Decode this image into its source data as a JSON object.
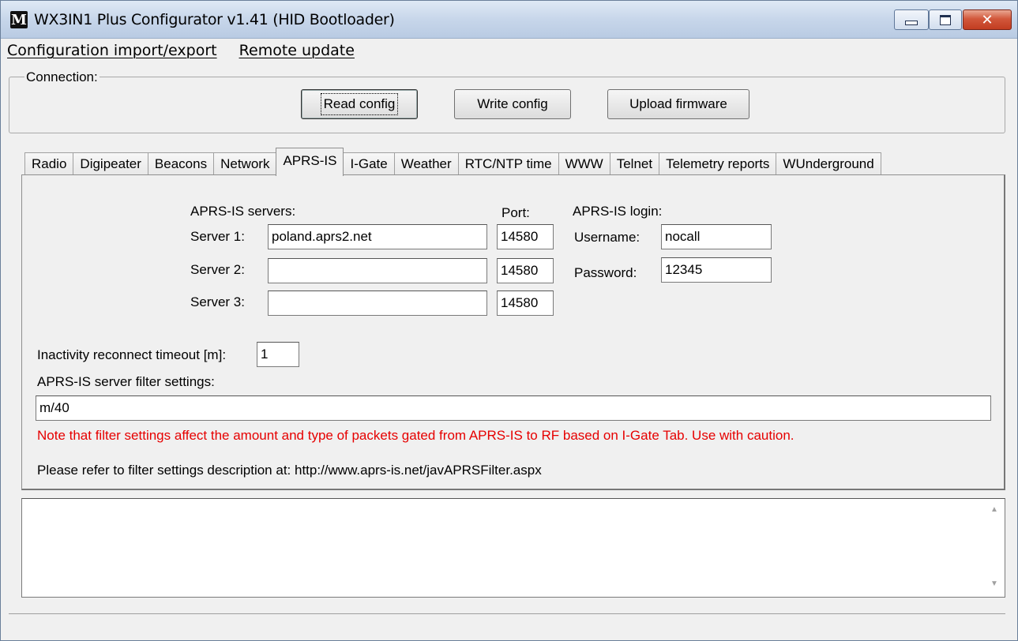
{
  "window": {
    "title": "WX3IN1 Plus Configurator v1.41 (HID Bootloader)",
    "icon_letter": "M"
  },
  "menu": {
    "items": [
      {
        "label": "C",
        "rest": "onfiguration import/export"
      },
      {
        "label": "R",
        "rest": "emote update"
      }
    ]
  },
  "connection": {
    "legend": "Connection:",
    "read_label": "Read config",
    "write_label": "Write config",
    "upload_label": "Upload firmware"
  },
  "tabs": [
    "Radio",
    "Digipeater",
    "Beacons",
    "Network",
    "APRS-IS",
    "I-Gate",
    "Weather",
    "RTC/NTP time",
    "WWW",
    "Telnet",
    "Telemetry reports",
    "WUnderground"
  ],
  "active_tab": "APRS-IS",
  "aprsis": {
    "servers_header": "APRS-IS servers:",
    "port_header": "Port:",
    "login_header": "APRS-IS login:",
    "servers": [
      {
        "label": "Server 1:",
        "value": "poland.aprs2.net",
        "port": "14580"
      },
      {
        "label": "Server 2:",
        "value": "",
        "port": "14580"
      },
      {
        "label": "Server 3:",
        "value": "",
        "port": "14580"
      }
    ],
    "username_label": "Username:",
    "username_value": "nocall",
    "password_label": "Password:",
    "password_value": "12345",
    "timeout_label": "Inactivity reconnect timeout [m]:",
    "timeout_value": "1",
    "filter_label": "APRS-IS server filter settings:",
    "filter_value": "m/40",
    "warning_text": "Note that filter settings affect the amount and type of packets gated from APRS-IS to RF based on I-Gate Tab. Use with caution.",
    "info_text": "Please refer to filter settings description at: http://www.aprs-is.net/javAPRSFilter.aspx"
  },
  "colors": {
    "warning": "#e60000",
    "close_button": "#c23d21"
  }
}
